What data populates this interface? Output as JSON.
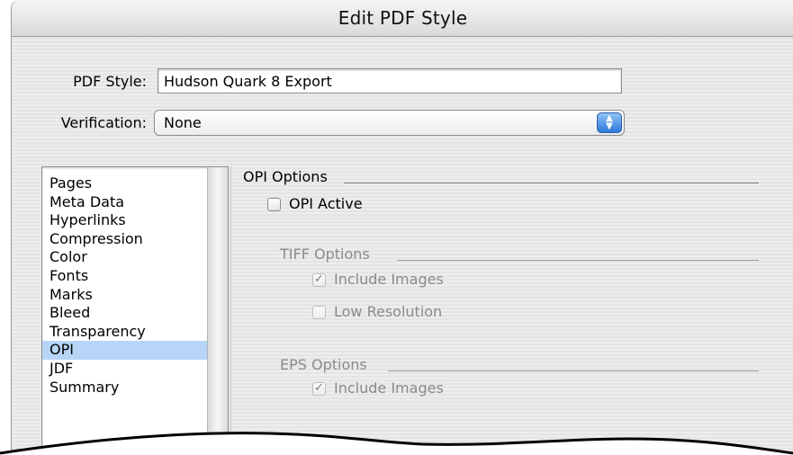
{
  "window": {
    "title": "Edit PDF Style"
  },
  "form": {
    "pdf_style_label": "PDF Style:",
    "pdf_style_value": "Hudson Quark 8 Export",
    "verification_label": "Verification:",
    "verification_value": "None"
  },
  "sidebar": {
    "items": [
      {
        "label": "Pages"
      },
      {
        "label": "Meta Data"
      },
      {
        "label": "Hyperlinks"
      },
      {
        "label": "Compression"
      },
      {
        "label": "Color"
      },
      {
        "label": "Fonts"
      },
      {
        "label": "Marks"
      },
      {
        "label": "Bleed"
      },
      {
        "label": "Transparency"
      },
      {
        "label": "OPI"
      },
      {
        "label": "JDF"
      },
      {
        "label": "Summary"
      }
    ],
    "selected": "OPI"
  },
  "opi": {
    "group_title": "OPI Options",
    "opi_active_label": "OPI Active",
    "opi_active_checked": false,
    "tiff": {
      "title": "TIFF Options",
      "include_images_label": "Include Images",
      "include_images_checked": true,
      "low_resolution_label": "Low Resolution",
      "low_resolution_checked": false
    },
    "eps": {
      "title": "EPS Options",
      "include_images_label": "Include Images",
      "include_images_checked": true
    }
  },
  "icons": {
    "popup_arrows": "up-down-arrows-icon",
    "checkmark": "checkmark-icon"
  },
  "colors": {
    "selection": "#b7d5f7",
    "stepper_blue": "#2d79d9",
    "disabled_text": "#8a8a8a"
  }
}
